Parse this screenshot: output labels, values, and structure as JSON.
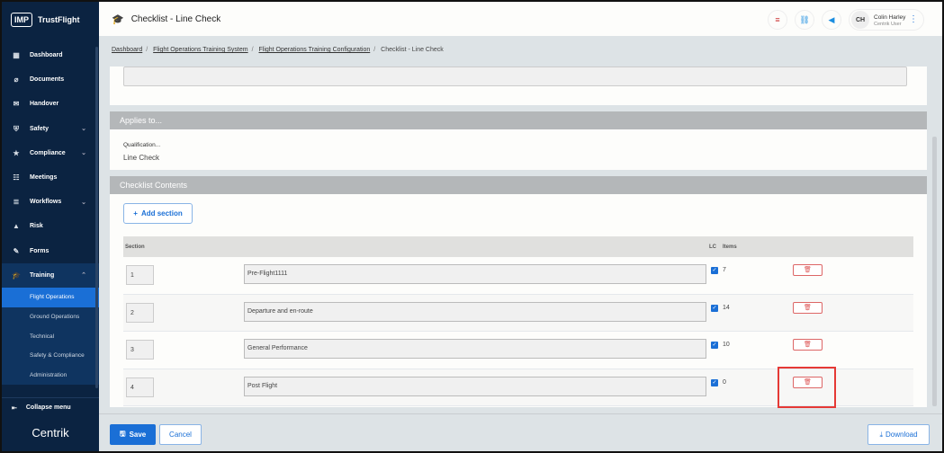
{
  "app": {
    "logo_badge": "IMP",
    "logo_text": "TrustFlight",
    "brand": "Centrik"
  },
  "sidebar": {
    "items": [
      {
        "label": "Dashboard",
        "icon": "dashboard-icon",
        "glyph": "▦"
      },
      {
        "label": "Documents",
        "icon": "paperclip-icon",
        "glyph": "⌀"
      },
      {
        "label": "Handover",
        "icon": "handover-icon",
        "glyph": "✉"
      },
      {
        "label": "Safety",
        "icon": "shield-icon",
        "glyph": "⛨",
        "chevron": "⌄"
      },
      {
        "label": "Compliance",
        "icon": "compliance-icon",
        "glyph": "★",
        "chevron": "⌄"
      },
      {
        "label": "Meetings",
        "icon": "meetings-icon",
        "glyph": "☷"
      },
      {
        "label": "Workflows",
        "icon": "workflows-icon",
        "glyph": "≣",
        "chevron": "⌄"
      },
      {
        "label": "Risk",
        "icon": "risk-icon",
        "glyph": "▲"
      },
      {
        "label": "Forms",
        "icon": "forms-icon",
        "glyph": "✎"
      }
    ],
    "training": {
      "label": "Training",
      "glyph": "🎓",
      "chevron": "⌃",
      "sub": [
        "Flight Operations",
        "Ground Operations",
        "Technical",
        "Safety & Compliance",
        "Administration"
      ]
    },
    "collapse": "Collapse menu"
  },
  "header": {
    "title": "Checklist",
    "subtitle": "Line Check",
    "user_initials": "CH",
    "user_name": "Colin Harley",
    "user_role": "Centrik User"
  },
  "breadcrumb": [
    "Dashboard",
    "Flight Operations Training System",
    "Flight Operations Training Configuration",
    "Checklist - Line Check"
  ],
  "applies": {
    "heading": "Applies to...",
    "qual_label": "Qualification...",
    "qual_value": "Line Check"
  },
  "contents": {
    "heading": "Checklist Contents",
    "add_label": "Add section",
    "col_section": "Section",
    "col_lc": "LC",
    "col_items": "Items",
    "rows": [
      {
        "num": "1",
        "name": "Pre-Flight1111",
        "lc": true,
        "items": "7"
      },
      {
        "num": "2",
        "name": "Departure and en-route",
        "lc": true,
        "items": "14"
      },
      {
        "num": "3",
        "name": "General Performance",
        "lc": true,
        "items": "10"
      },
      {
        "num": "4",
        "name": "Post Flight",
        "lc": true,
        "items": "0"
      }
    ]
  },
  "footer": {
    "save": "Save",
    "cancel": "Cancel",
    "download": "Download"
  },
  "colors": {
    "accent": "#1a6fd6",
    "sidebar": "#0b2341",
    "danger": "#e53935"
  }
}
